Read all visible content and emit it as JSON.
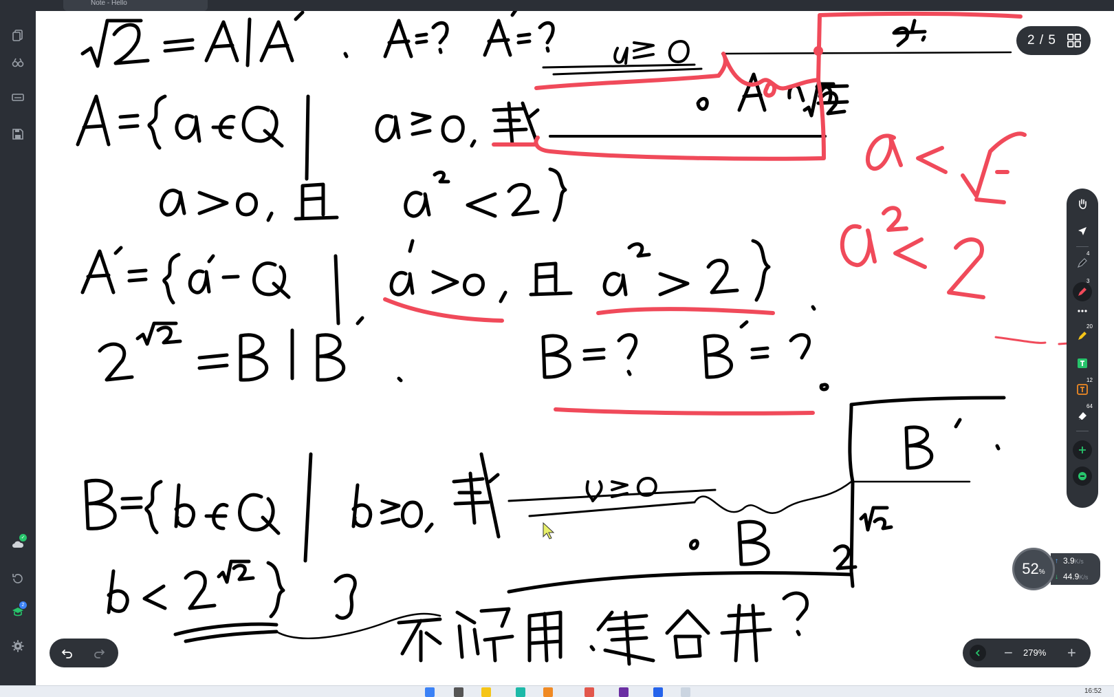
{
  "window": {
    "tab_title": "Note - Hello"
  },
  "pager": {
    "label": "2 / 5"
  },
  "zoom": {
    "level": "279%"
  },
  "netmeter": {
    "cpu_percent": "52",
    "percent_sign": "%",
    "up": "3.9",
    "down": "44.9",
    "unit": "K/s"
  },
  "leftrail": {
    "cloud_badge": "✓",
    "update_badge": "2"
  },
  "righttools": {
    "pen_badge": "4",
    "highlighter_badge": "3",
    "marker_badge": "20",
    "text_badge": "12",
    "eraser_badge": "64"
  },
  "taskbar": {
    "clock": "16:52"
  },
  "colors": {
    "ink_black": "#000000",
    "ink_red": "#f04a5a",
    "chrome": "#2e3238",
    "accent": "#1db9a8"
  }
}
